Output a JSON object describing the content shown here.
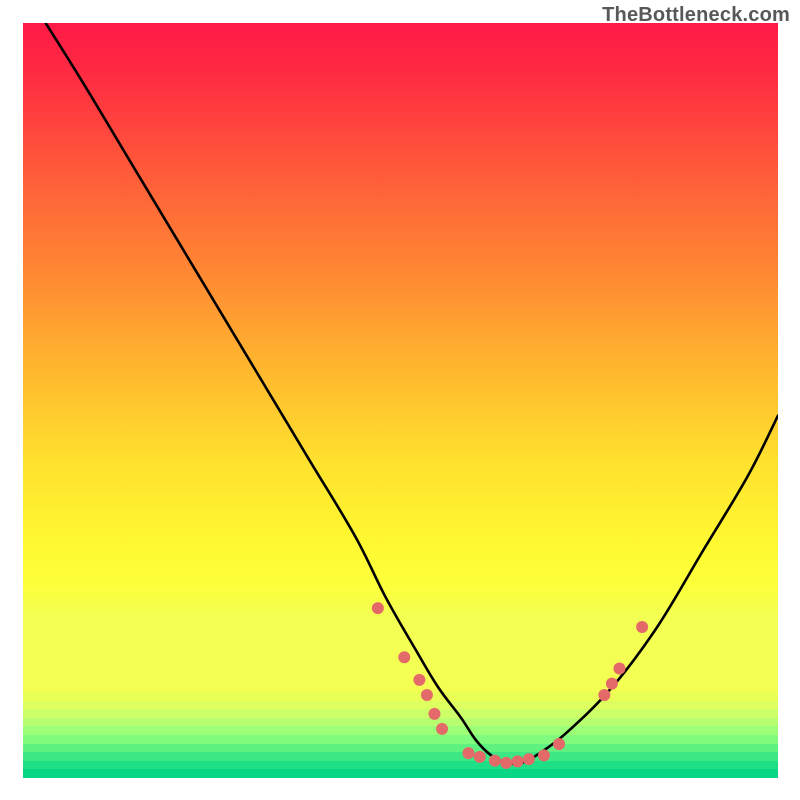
{
  "watermark": "TheBottleneck.com",
  "colors": {
    "curve": "#000000",
    "dot_fill": "#e46a6a",
    "dot_stroke": "#c94a4a"
  },
  "chart_data": {
    "type": "line",
    "title": "",
    "xlabel": "",
    "ylabel": "",
    "xlim": [
      0,
      100
    ],
    "ylim": [
      0,
      100
    ],
    "grid": false,
    "legend": false,
    "series": [
      {
        "name": "bottleneck-curve",
        "x": [
          3,
          8,
          14,
          20,
          26,
          32,
          38,
          44,
          48,
          52,
          55,
          58,
          60,
          62,
          64,
          66,
          68,
          72,
          78,
          84,
          90,
          96,
          100
        ],
        "y": [
          100,
          92,
          82,
          72,
          62,
          52,
          42,
          32,
          24,
          17,
          12,
          8,
          5,
          3,
          2,
          2,
          3,
          6,
          12,
          20,
          30,
          40,
          48
        ]
      }
    ],
    "markers": [
      {
        "x": 47.0,
        "y": 22.5
      },
      {
        "x": 50.5,
        "y": 16.0
      },
      {
        "x": 52.5,
        "y": 13.0
      },
      {
        "x": 53.5,
        "y": 11.0
      },
      {
        "x": 54.5,
        "y": 8.5
      },
      {
        "x": 55.5,
        "y": 6.5
      },
      {
        "x": 59.0,
        "y": 3.3
      },
      {
        "x": 60.5,
        "y": 2.8
      },
      {
        "x": 62.5,
        "y": 2.3
      },
      {
        "x": 64.0,
        "y": 2.0
      },
      {
        "x": 65.5,
        "y": 2.2
      },
      {
        "x": 67.0,
        "y": 2.5
      },
      {
        "x": 69.0,
        "y": 3.0
      },
      {
        "x": 71.0,
        "y": 4.5
      },
      {
        "x": 77.0,
        "y": 11.0
      },
      {
        "x": 78.0,
        "y": 12.5
      },
      {
        "x": 79.0,
        "y": 14.5
      },
      {
        "x": 82.0,
        "y": 20.0
      }
    ],
    "dot_radius": 6
  }
}
